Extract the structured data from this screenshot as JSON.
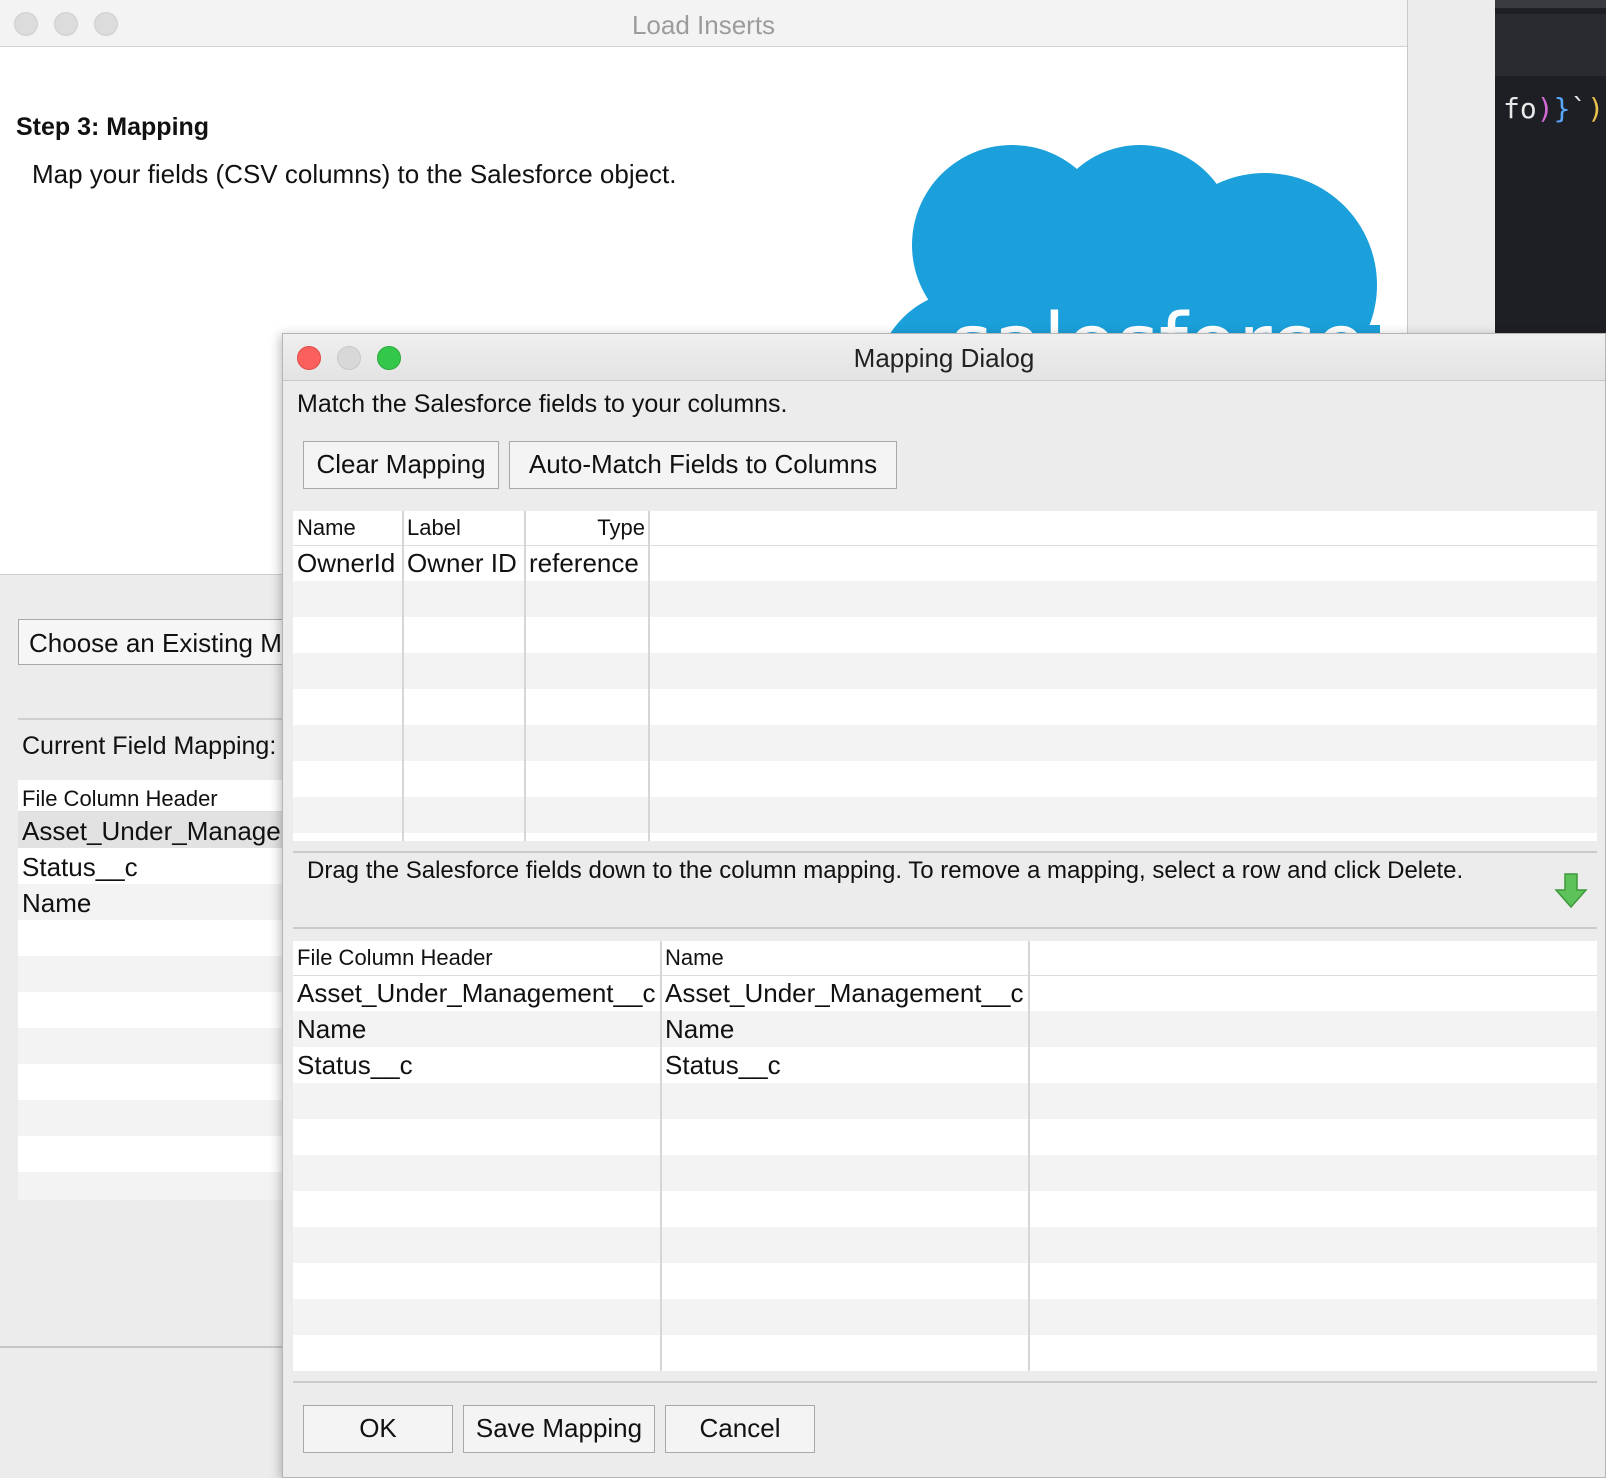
{
  "editor": {
    "code_tokens": [
      "fo",
      ")",
      "}",
      "`",
      ")"
    ]
  },
  "back_window": {
    "title": "Load Inserts",
    "step_title": "Step 3: Mapping",
    "step_desc": "Map your fields (CSV columns) to the Salesforce object.",
    "logo_text": "salesforce",
    "choose_button": "Choose an Existing M",
    "current_label": "Current Field Mapping:",
    "table_header": "File Column Header",
    "rows": [
      "Asset_Under_Manage",
      "Status__c",
      "Name"
    ]
  },
  "dialog": {
    "title": "Mapping Dialog",
    "instruction": "Match the Salesforce fields to your columns.",
    "clear_button": "Clear Mapping",
    "automatch_button": "Auto-Match Fields to Columns",
    "fields_table": {
      "headers": [
        "Name",
        "Label",
        "Type"
      ],
      "rows": [
        {
          "name": "OwnerId",
          "label": "Owner ID",
          "type": "reference"
        }
      ]
    },
    "drag_instruction": "Drag the Salesforce fields down to the column mapping.  To remove a mapping, select a row and click Delete.",
    "mapping_table": {
      "headers": [
        "File Column Header",
        "Name"
      ],
      "rows": [
        {
          "file": "Asset_Under_Management__c",
          "name": "Asset_Under_Management__c"
        },
        {
          "file": "Name",
          "name": "Name"
        },
        {
          "file": "Status__c",
          "name": "Status__c"
        }
      ]
    },
    "ok_button": "OK",
    "save_button": "Save Mapping",
    "cancel_button": "Cancel"
  },
  "colors": {
    "salesforce_blue": "#1ba0db",
    "close_red": "#fc605c",
    "zoom_green": "#34c84a",
    "arrow_green": "#5ec25a"
  }
}
